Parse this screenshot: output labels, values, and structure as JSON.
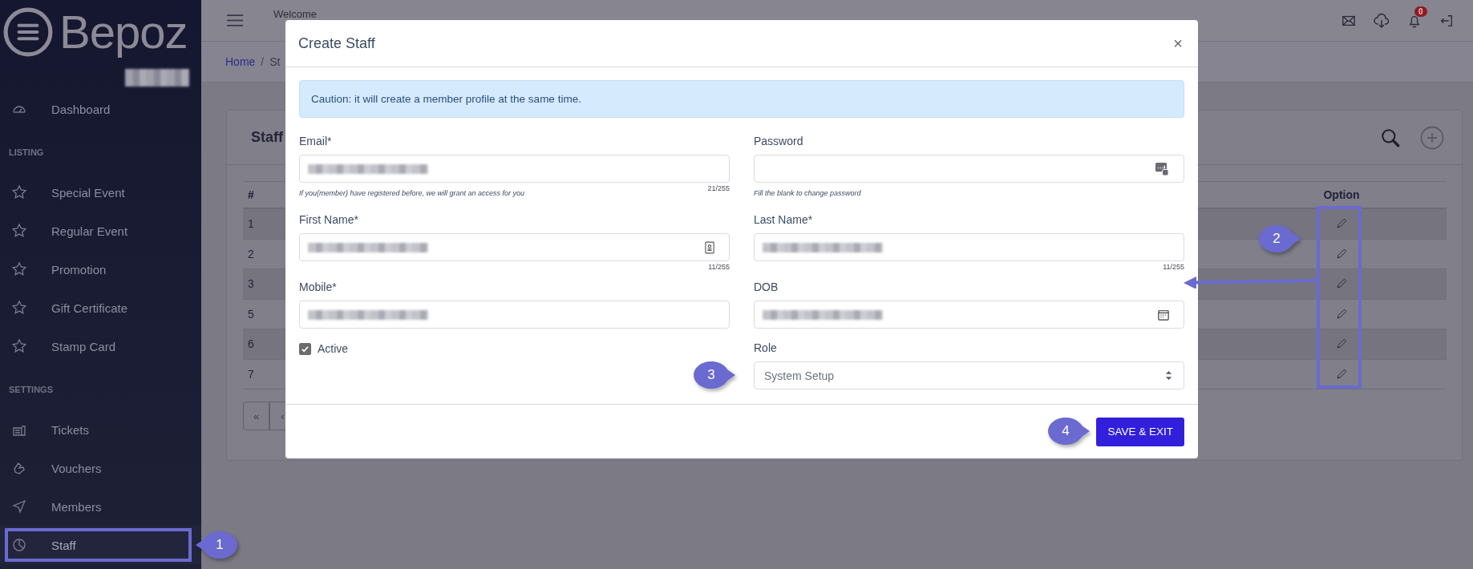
{
  "sidebar": {
    "logo": "Bepoz",
    "user_hidden": true,
    "items": [
      {
        "kind": "item",
        "label": "Dashboard",
        "selected": false
      },
      {
        "kind": "heading",
        "label": "LISTING"
      },
      {
        "kind": "item",
        "label": "Special Event",
        "selected": false
      },
      {
        "kind": "item",
        "label": "Regular Event",
        "selected": false
      },
      {
        "kind": "item",
        "label": "Promotion",
        "selected": false
      },
      {
        "kind": "item",
        "label": "Gift Certificate",
        "selected": false
      },
      {
        "kind": "item",
        "label": "Stamp Card",
        "selected": false
      },
      {
        "kind": "heading",
        "label": "SETTINGS"
      },
      {
        "kind": "item",
        "label": "Tickets",
        "selected": false
      },
      {
        "kind": "item",
        "label": "Vouchers",
        "selected": false
      },
      {
        "kind": "item",
        "label": "Members",
        "selected": false
      },
      {
        "kind": "item",
        "label": "Staff",
        "selected": true
      }
    ]
  },
  "header": {
    "welcome": "Welcome",
    "notifications": "0"
  },
  "breadcrumb": {
    "items": [
      "Home",
      "St"
    ],
    "separator": "/"
  },
  "card": {
    "title": "Staff",
    "table": {
      "columns": [
        "#",
        "Option"
      ],
      "rows": [
        {
          "number": "1"
        },
        {
          "number": "2"
        },
        {
          "number": "3"
        },
        {
          "number": "5"
        },
        {
          "number": "6"
        },
        {
          "number": "7"
        }
      ]
    },
    "pagination": [
      "«",
      "‹"
    ]
  },
  "modal": {
    "title": "Create Staff",
    "close": "×",
    "alert": "Caution: it will create a member profile at the same time.",
    "fields": [
      {
        "label": "Email*",
        "kind": "email",
        "value_hidden": true,
        "hint": "If you(member) have registered before, we will grant an access for you",
        "counter": "21/255"
      },
      {
        "label": "Password",
        "kind": "password",
        "hint": "Fill the blank to change password"
      },
      {
        "label": "First Name*",
        "kind": "contact",
        "value_hidden": true,
        "counter": "11/255"
      },
      {
        "label": "Last Name*",
        "kind": "plain",
        "value_hidden": true,
        "counter": "11/255"
      },
      {
        "label": "Mobile*",
        "kind": "plain",
        "value_hidden": true
      },
      {
        "label": "DOB",
        "kind": "date",
        "value_hidden": true
      },
      {
        "label": "Active",
        "kind": "checkbox",
        "checked": true
      },
      {
        "label": "Role",
        "kind": "select",
        "value": "System Setup"
      }
    ],
    "save_button": "SAVE & EXIT"
  },
  "annotations": [
    {
      "number": "1"
    },
    {
      "number": "2"
    },
    {
      "number": "3"
    },
    {
      "number": "4"
    }
  ]
}
